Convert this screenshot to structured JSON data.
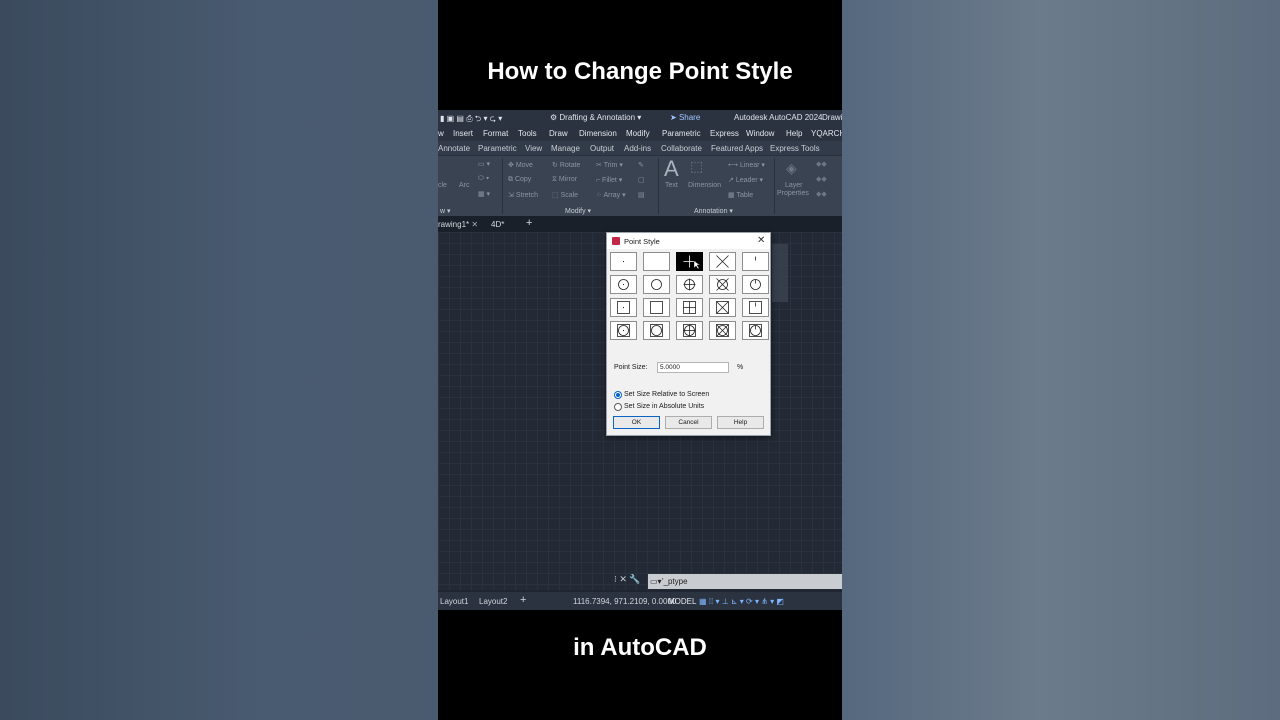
{
  "captions": {
    "top": "How to Change Point Style",
    "bottom": "in AutoCAD"
  },
  "qat": {
    "workspace": "Drafting & Annotation",
    "share": "Share",
    "app_title": "Autodesk AutoCAD 2024",
    "doc_title": "Drawi"
  },
  "menubar": [
    "w",
    "Insert",
    "Format",
    "Tools",
    "Draw",
    "Dimension",
    "Modify",
    "Parametric",
    "Express",
    "Window",
    "Help",
    "YQARCH"
  ],
  "ribbon_tabs": [
    "Annotate",
    "Parametric",
    "View",
    "Manage",
    "Output",
    "Add-ins",
    "Collaborate",
    "Featured Apps",
    "Express Tools"
  ],
  "ribbon": {
    "tools": {
      "cle": "cle",
      "arc": "Arc",
      "move": "Move",
      "rotate": "Rotate",
      "trim": "Trim",
      "copy": "Copy",
      "mirror": "Mirror",
      "fillet": "Fillet",
      "stretch": "Stretch",
      "scale": "Scale",
      "array": "Array",
      "text": "Text",
      "dimension": "Dimension",
      "linear": "Linear",
      "leader": "Leader",
      "table": "Table",
      "layer": "Layer",
      "properties": "Properties"
    },
    "panels": {
      "draw": "w ▾",
      "modify": "Modify ▾",
      "annotation": "Annotation ▾"
    }
  },
  "file_tabs": {
    "drawing1": "rawing1*",
    "drawing2": "4D*"
  },
  "dialog": {
    "title": "Point Style",
    "point_size_label": "Point Size:",
    "point_size_value": "5.0000",
    "unit": "%",
    "radio_relative": "Set Size Relative to Screen",
    "radio_absolute": "Set Size in Absolute Units",
    "relative_selected": true,
    "ok": "OK",
    "cancel": "Cancel",
    "help": "Help",
    "selected_style_index": 2
  },
  "command_line": {
    "text": "'_ptype"
  },
  "status_bar": {
    "layout1": "Layout1",
    "layout2": "Layout2",
    "coords": "1116.7394, 971.2109, 0.0000",
    "model": "MODEL"
  }
}
